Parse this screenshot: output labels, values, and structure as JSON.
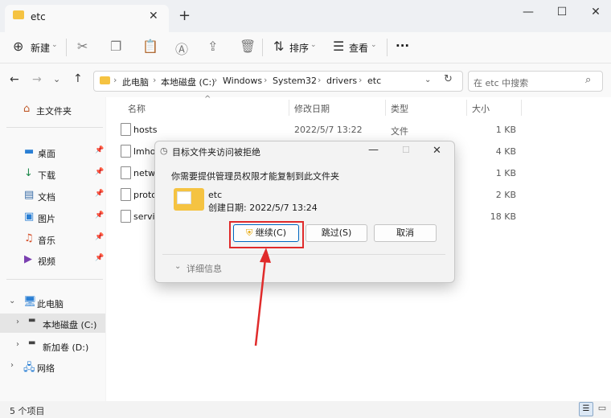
{
  "window": {
    "tab_title": "etc",
    "tab_close": "✕",
    "new_tab": "+",
    "minimize": "—",
    "maximize": "☐",
    "close": "✕"
  },
  "toolbar": {
    "new_label": "新建",
    "sort_label": "排序",
    "view_label": "查看",
    "more_label": "···"
  },
  "nav": {
    "breadcrumbs": [
      "此电脑",
      "本地磁盘 (C:)",
      "Windows",
      "System32",
      "drivers",
      "etc"
    ],
    "search_placeholder": "在 etc 中搜索"
  },
  "sidebar": {
    "home": "主文件夹",
    "quick": [
      {
        "label": "桌面",
        "icon": "desktop-icon"
      },
      {
        "label": "下载",
        "icon": "download-icon"
      },
      {
        "label": "文档",
        "icon": "documents-icon"
      },
      {
        "label": "图片",
        "icon": "pictures-icon"
      },
      {
        "label": "音乐",
        "icon": "music-icon"
      },
      {
        "label": "视频",
        "icon": "videos-icon"
      }
    ],
    "this_pc": "此电脑",
    "drives": [
      "本地磁盘 (C:)",
      "新加卷 (D:)"
    ],
    "network": "网络"
  },
  "table": {
    "headers": [
      "名称",
      "修改日期",
      "类型",
      "大小"
    ],
    "rows": [
      {
        "name": "hosts",
        "date": "2022/5/7 13:22",
        "type": "文件",
        "size": "1 KB"
      },
      {
        "name": "lmho",
        "date": "",
        "type": "",
        "size": "4 KB"
      },
      {
        "name": "netw",
        "date": "",
        "type": "",
        "size": "1 KB"
      },
      {
        "name": "proto",
        "date": "",
        "type": "",
        "size": "2 KB"
      },
      {
        "name": "servic",
        "date": "",
        "type": "",
        "size": "18 KB"
      }
    ]
  },
  "dialog": {
    "title": "目标文件夹访问被拒绝",
    "message": "你需要提供管理员权限才能复制到此文件夹",
    "folder_name": "etc",
    "created": "创建日期: 2022/5/7 13:24",
    "continue_label": "继续(C)",
    "skip_label": "跳过(S)",
    "cancel_label": "取消",
    "details_label": "详细信息",
    "close": "✕"
  },
  "status": {
    "item_count": "5 个项目"
  },
  "colors": {
    "accent": "#0067c0",
    "folder": "#f5c342",
    "annotation_red": "#e02b2b"
  }
}
